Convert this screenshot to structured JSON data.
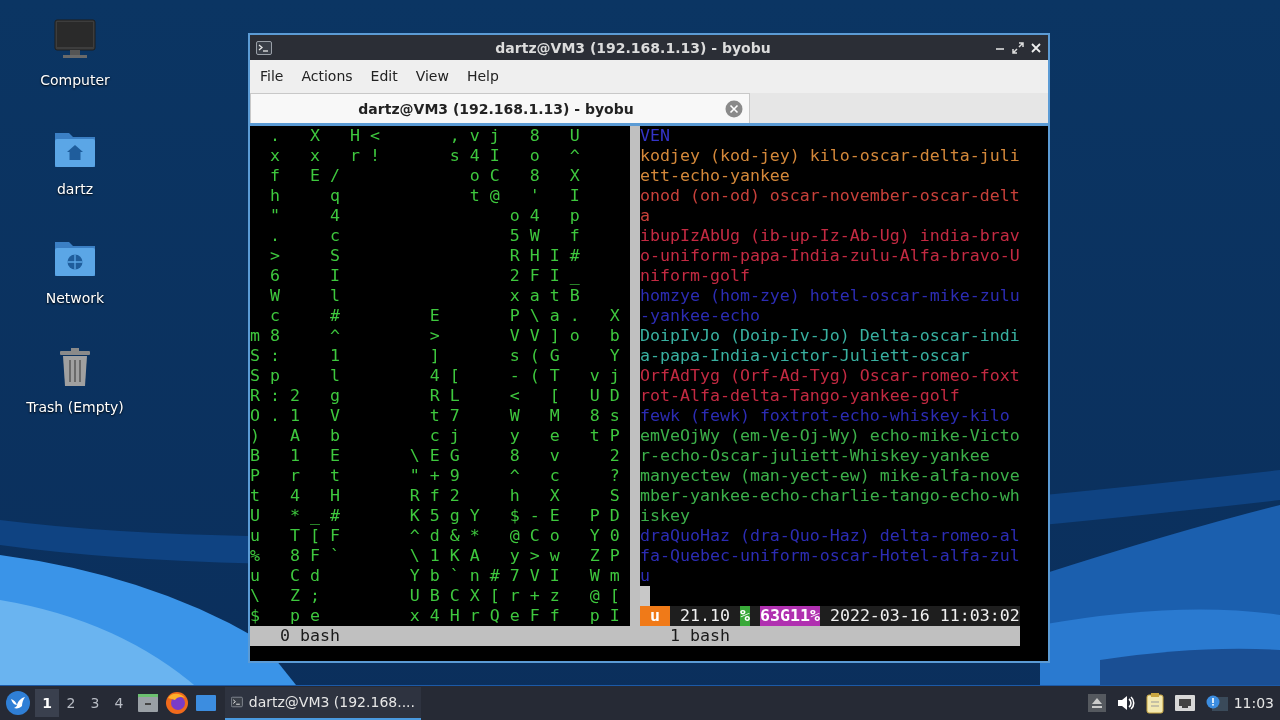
{
  "desktop_icons": [
    {
      "label": "Computer",
      "kind": "computer"
    },
    {
      "label": "dartz",
      "kind": "home"
    },
    {
      "label": "Network",
      "kind": "network"
    },
    {
      "label": "Trash (Empty)",
      "kind": "trash"
    }
  ],
  "window": {
    "title": "dartz@VM3 (192.168.1.13) - byobu",
    "menu": [
      "File",
      "Actions",
      "Edit",
      "View",
      "Help"
    ],
    "tabs": [
      {
        "label": "dartz@VM3 (192.168.1.13) - byobu",
        "selected": true
      }
    ],
    "left_pane": {
      "rows": [
        "  .   X   H <       , v j   8   U",
        "  x   x   r !       s 4 I   o   ^",
        "  f   E /             o C   8   X",
        "  h     q             t @   '   I",
        "  \"     4                 o 4   p",
        "  .     c                 5 W   f",
        "  >     S                 R H I #",
        "  6     I                 2 F I _",
        "  W     l                 x a t B",
        "  c     #         E       P \\ a .   X",
        "m 8     ^         >       V V ] o   b",
        "S :     1         ]       s ( G     Y",
        "S p     l         4 [     - ( T   v j",
        "R : 2   g         R L     <   [   U D",
        "O . 1   V         t 7     W   M   8 s",
        ")   A   b         c j     y   e   t P",
        "B   1   E       \\ E G     8   v     2",
        "P   r   t       \" + 9     ^   c     ?",
        "t   4   H       R f 2     h   X     S",
        "U   * _ #       K 5 g Y   $ - E   P D",
        "u   T [ F       ^ d & *   @ C o   Y 0",
        "%   8 F `       \\ 1 K A   y > w   Z P",
        "u   C d         Y b ` n # 7 V I   W m",
        "\\   Z ;         U B C X [ r + z   @ [",
        "$   p e         x 4 H r Q e F f   p I"
      ]
    },
    "right_pane": {
      "partial_line": "VEN",
      "lines": [
        {
          "text": "kodjey (kod-jey) kilo-oscar-delta-juliett-echo-yankee",
          "color": "#d4883a"
        },
        {
          "text": "onod (on-od) oscar-november-oscar-delta",
          "color": "#c8403a"
        },
        {
          "text": "ibupIzAbUg (ib-up-Iz-Ab-Ug) india-bravo-uniform-papa-India-zulu-Alfa-bravo-Uniform-golf",
          "color": "#c42a42"
        },
        {
          "text": "homzye (hom-zye) hotel-oscar-mike-zulu-yankee-echo",
          "color": "#2c2cb4"
        },
        {
          "text": "DoipIvJo (Doip-Iv-Jo) Delta-oscar-india-papa-India-victor-Juliett-oscar",
          "color": "#38b0a0"
        },
        {
          "text": "OrfAdTyg (Orf-Ad-Tyg) Oscar-romeo-foxtrot-Alfa-delta-Tango-yankee-golf",
          "color": "#c42a42"
        },
        {
          "text": "fewk (fewk) foxtrot-echo-whiskey-kilo",
          "color": "#2c2cb4"
        },
        {
          "text": "emVeOjWy (em-Ve-Oj-Wy) echo-mike-Victor-echo-Oscar-juliett-Whiskey-yankee",
          "color": "#3cb04a"
        },
        {
          "text": "manyectew (man-yect-ew) mike-alfa-november-yankee-echo-charlie-tango-echo-whiskey",
          "color": "#3cb04a"
        },
        {
          "text": "draQuoHaz (dra-Quo-Haz) delta-romeo-alfa-Quebec-uniform-oscar-Hotel-alfa-zulu",
          "color": "#2c2cb4"
        }
      ]
    },
    "status_bar": [
      {
        "text": "u",
        "kind": "badge",
        "color": "#f07a18"
      },
      {
        "text": "21.10",
        "kind": "plain"
      },
      {
        "text": "%",
        "kind": "badge",
        "color": "#38a838"
      },
      {
        "text": "63G11%",
        "kind": "badge",
        "color": "#b030b0"
      },
      {
        "text": "2022-03-16 11:03:02",
        "kind": "plain"
      }
    ],
    "window_list": [
      "0 bash",
      "1 bash"
    ]
  },
  "taskbar": {
    "workspaces": [
      {
        "label": "1",
        "selected": true
      },
      {
        "label": "2",
        "selected": false
      },
      {
        "label": "3",
        "selected": false
      },
      {
        "label": "4",
        "selected": false
      }
    ],
    "tasks": [
      {
        "label": "dartz@VM3 (192.168....",
        "selected": true
      }
    ],
    "clock": "11:03"
  }
}
